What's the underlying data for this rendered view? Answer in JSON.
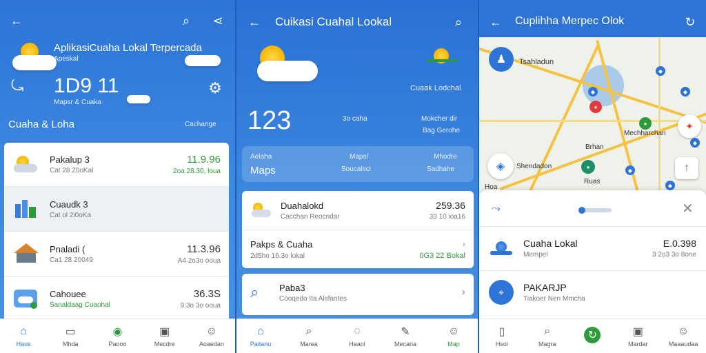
{
  "panel1": {
    "app_title": "AplikasiCuaha Lokal Terpercada",
    "subtitle": "Apeskal",
    "temp_big": "1D9 11",
    "sub_info": "Mapsr & Cuaka",
    "section_left": "Cuaha & Loha",
    "section_right": "Cachange",
    "list": [
      {
        "title": "Pakalup 3",
        "sub": "Cat 28 20oKal",
        "value": "11.9.96",
        "value_sub": "2oa 28.30, loua"
      },
      {
        "title": "Cuaudk 3",
        "sub": "Cat ol 2i0oKa",
        "value": "",
        "value_sub": ""
      },
      {
        "title": "Pnaladi (",
        "sub": "Ca1 28 20049",
        "value": "11.3.96",
        "value_sub": "A4 2o3o ooua"
      },
      {
        "title": "Cahouee",
        "sub": "Sanaldaag Cuaohal",
        "value": "36.3S",
        "value_sub": "9:3o 3o ooua"
      }
    ],
    "nav": [
      "Haus",
      "Mhda",
      "Paooo",
      "Mecdre",
      "Aoaedan"
    ]
  },
  "panel2": {
    "app_title": "Cuikasi Cuahal Lookal",
    "temp_big": "123",
    "mid_left": "3o caha",
    "right_label": "Cuaak Lodchal",
    "right_sub1": "Mokcher dir",
    "right_sub2": "Bag Gerohe",
    "strip": {
      "l1": "Aelaha",
      "l2": "Maps",
      "m1": "Maps/",
      "m2": "Soucalscl",
      "r1": "Mhodre",
      "r2": "Sadhahe"
    },
    "card1": [
      {
        "title": "Duahalokd",
        "sub": "Cacchan Reocndar",
        "value": "259.36",
        "value_sub": "33 10 ioa16"
      },
      {
        "title": "Pakps & Cuaha",
        "sub": "2d5ho 16.3o lokal",
        "value": "",
        "value_sub": "0G3 22 Bokal"
      }
    ],
    "card2": {
      "title": "Paba3",
      "sub": "Cooqedo Ita Alsfantes"
    },
    "nav": [
      "Paitanu",
      "Marea",
      "Heaol",
      "Mecaria",
      "Map"
    ]
  },
  "panel3": {
    "app_title": "Cuplihha Merpec Olok",
    "map_labels": [
      "Tsahladun",
      "Mechharchan",
      "Brhan",
      "Shendadon",
      "Ruas",
      "Hoa"
    ],
    "sheet": [
      {
        "title": "Cuaha Lokal",
        "sub": "Mempel",
        "value": "E.0.398",
        "value_sub": "3 2o3 3o 8one"
      },
      {
        "title": "PAKARJP",
        "sub": "Tiakoer Nen Mmcha",
        "value": "",
        "value_sub": ""
      }
    ],
    "nav": [
      "Hsol",
      "Magra",
      "",
      "Mardar",
      "Maaaudaa"
    ]
  },
  "colors": {
    "primary": "#2d74d6",
    "accent_green": "#2e9b3a",
    "map_bg": "#eef2ea"
  }
}
